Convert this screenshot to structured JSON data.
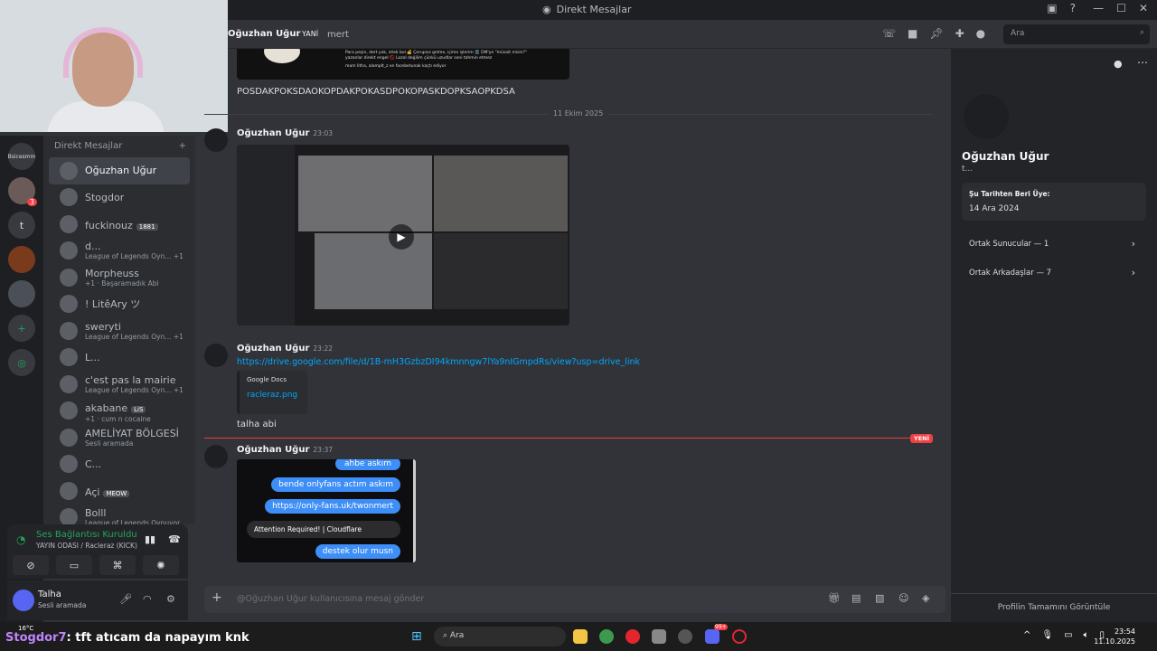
{
  "window": {
    "title": "Direkt Mesajlar"
  },
  "header": {
    "user_name": "Oğuzhan Uğur",
    "new_label": "YANİ",
    "extra": "mert",
    "search_placeholder": "Ara"
  },
  "rail": {
    "label_top": "Bsicesmm",
    "badge": "3",
    "letter": "t"
  },
  "dm_list": {
    "title": "Direkt Mesajlar",
    "add": "+",
    "items": [
      {
        "name": "Oğuzhan Uğur",
        "sub": "",
        "tag": ""
      },
      {
        "name": "Stogdor",
        "sub": "",
        "tag": ""
      },
      {
        "name": "fuckinouz",
        "sub": "",
        "tag": "1881"
      },
      {
        "name": "d...",
        "sub": "League of Legends Oyn... +1",
        "tag": ""
      },
      {
        "name": "Morpheuss",
        "sub": "+1 · Başaramadık Abi",
        "tag": ""
      },
      {
        "name": "! LitêAry ツ",
        "sub": "",
        "tag": ""
      },
      {
        "name": "sweryti",
        "sub": "League of Legends Oyn... +1",
        "tag": ""
      },
      {
        "name": "L...",
        "sub": "",
        "tag": ""
      },
      {
        "name": "c'est pas la mairie",
        "sub": "League of Legends Oyn... +1",
        "tag": ""
      },
      {
        "name": "akabane",
        "sub": "+1 · cum n cocaine",
        "tag": "LiS"
      },
      {
        "name": "AMELİYAT BÖLGESİ",
        "sub": "Sesli aramada",
        "tag": ""
      },
      {
        "name": "C...",
        "sub": "",
        "tag": ""
      },
      {
        "name": "Açi",
        "sub": "",
        "tag": "MEOW"
      },
      {
        "name": "Bolll",
        "sub": "League of Legends Oynuyor",
        "tag": ""
      }
    ]
  },
  "voice": {
    "status": "Ses Bağlantısı Kuruldu",
    "channel": "YAYIN ODASI / Racleraz (KICK)"
  },
  "user": {
    "name": "Talha",
    "status": "Sesli aramada"
  },
  "chat": {
    "embed_text_line1": "Para peşin, dert yok, istek bol 💰 Çerupsız gelme, içime işlerim 🗄️ DM'ye \"müsait misin?\"",
    "embed_text_line2": "yazanlar direkt engel 🚫 Lozol değilim çünkü uzudlar seni tahmin etmez",
    "embed_text_line3": "mam litha, alamplt_z ve facebetunak kaçtı ediyor",
    "m0_text": "POSDAKPOKSDAOKOPDAKPOKASDPOKOPASKDOPKSAOPKDSA",
    "date_divider": "11 Ekim 2025",
    "m1_author": "Oğuzhan Uğur",
    "m1_time": "23:03",
    "m2_author": "Oğuzhan Uğur",
    "m2_time": "23:22",
    "m2_link": "https://drive.google.com/file/d/1B-mH3GzbzDI94kmnngw7lYa9nIGmpdRs/view?usp=drive_link",
    "m2_embed_provider": "Google Docs",
    "m2_embed_title": "racleraz.png",
    "m2_text": "talha abi",
    "new_divider": "YENİ",
    "m3_author": "Oğuzhan Uğur",
    "m3_time": "23:37",
    "bubbles": [
      "ahbe askım",
      "bende onlyfans actım askım",
      "https://only-fans.uk/twonmert",
      "Attention Required! | Cloudflare",
      "destek olur musn"
    ]
  },
  "input": {
    "placeholder": "@Oğuzhan Uğur kullanıcısına mesaj gönder"
  },
  "profile": {
    "name": "Oğuzhan Uğur",
    "status": "t...",
    "member_since_label": "Şu Tarihten Beri Üye:",
    "member_since": "14 Ara 2024",
    "mutual_servers": "Ortak Sunucular — 1",
    "mutual_friends": "Ortak Arkadaşlar — 7",
    "view_full": "Profilin Tamamını Görüntüle"
  },
  "taskbar": {
    "search": "Ara",
    "time": "23:54",
    "date": "11.10.2025",
    "temp": "16°C",
    "notif": "99+"
  },
  "stream_caption": {
    "user": "Stogdor7",
    "text": ": tft atıcam da napayım knk"
  }
}
